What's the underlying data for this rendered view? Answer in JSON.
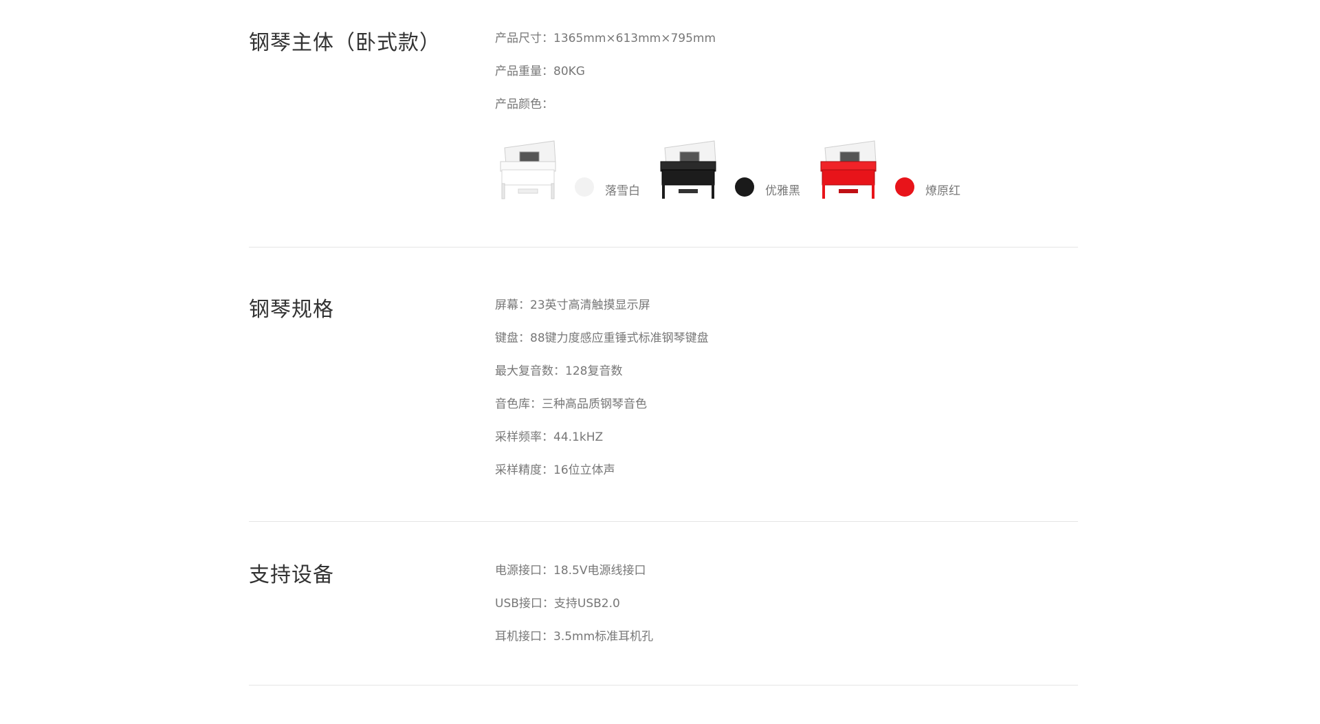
{
  "sections": {
    "body": {
      "title": "钢琴主体（卧式款）",
      "specs": {
        "size": "产品尺寸：1365mm×613mm×795mm",
        "weight": "产品重量：80KG",
        "color_label": "产品颜色："
      },
      "colors": [
        {
          "name": "落雪白",
          "swatch": "#f2f2f2",
          "body": "#f7f7f7",
          "trim": "#d8d8d8"
        },
        {
          "name": "优雅黑",
          "swatch": "#1a1a1a",
          "body": "#1c1c1c",
          "trim": "#555555"
        },
        {
          "name": "燎原红",
          "swatch": "#e8141a",
          "body": "#e8141a",
          "trim": "#a80c10"
        }
      ]
    },
    "specs": {
      "title": "钢琴规格",
      "items": [
        "屏幕：23英寸高清触摸显示屏",
        "键盘：88键力度感应重锤式标准钢琴键盘",
        "最大复音数：128复音数",
        "音色库：三种高品质钢琴音色",
        "采样频率：44.1kHZ",
        "采样精度：16位立体声"
      ]
    },
    "devices": {
      "title": "支持设备",
      "items": [
        "电源接口：18.5V电源线接口",
        "USB接口：支持USB2.0",
        "耳机接口：3.5mm标准耳机孔"
      ]
    }
  }
}
